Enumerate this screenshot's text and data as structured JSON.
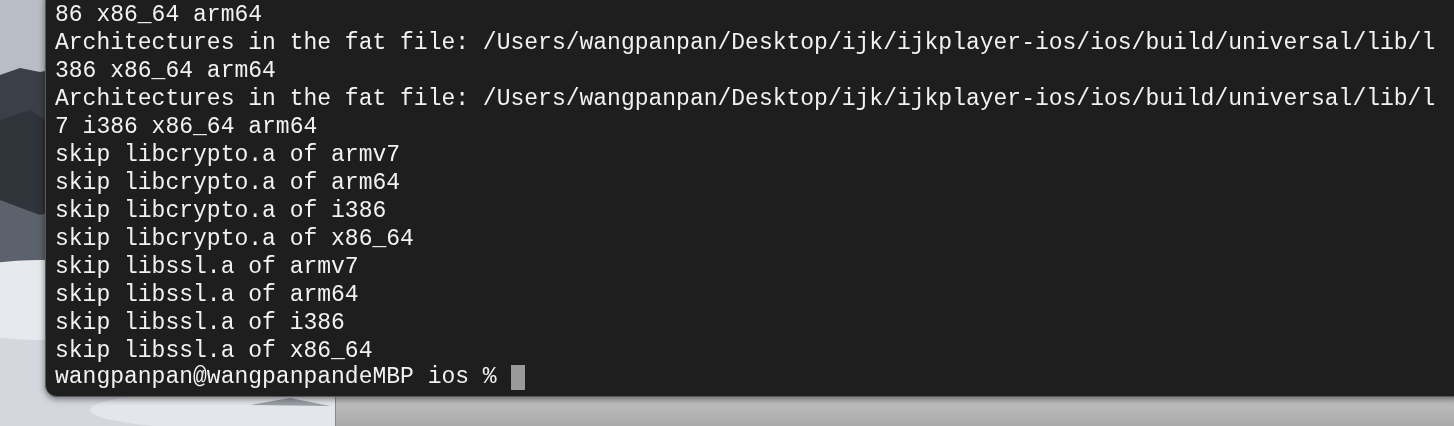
{
  "terminal": {
    "lines": [
      "86 x86_64 arm64",
      "Architectures in the fat file: /Users/wangpanpan/Desktop/ijk/ijkplayer-ios/ios/build/universal/lib/l",
      "386 x86_64 arm64",
      "Architectures in the fat file: /Users/wangpanpan/Desktop/ijk/ijkplayer-ios/ios/build/universal/lib/l",
      "7 i386 x86_64 arm64",
      "skip libcrypto.a of armv7",
      "skip libcrypto.a of arm64",
      "skip libcrypto.a of i386",
      "skip libcrypto.a of x86_64",
      "skip libssl.a of armv7",
      "skip libssl.a of arm64",
      "skip libssl.a of i386",
      "skip libssl.a of x86_64"
    ],
    "prompt": "wangpanpan@wangpanpandeMBP ios %"
  }
}
